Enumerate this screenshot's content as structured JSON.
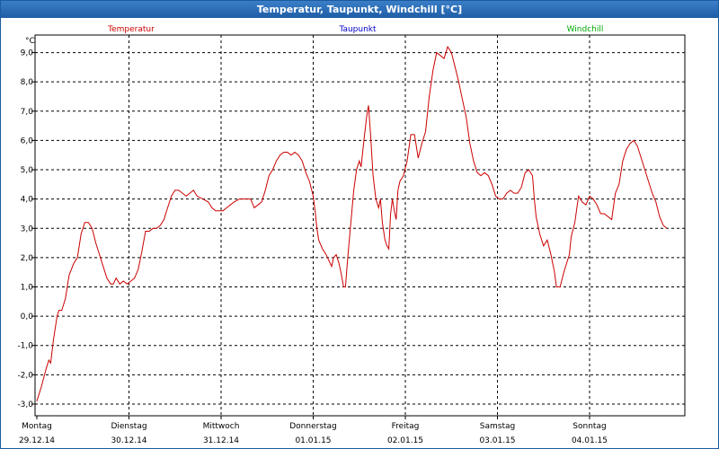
{
  "window": {
    "title": "Temperatur, Taupunkt, Windchill [°C]"
  },
  "legend": {
    "items": [
      {
        "name": "Temperatur",
        "color": "#cc0000"
      },
      {
        "name": "Taupunkt",
        "color": "#0000cc"
      },
      {
        "name": "Windchill",
        "color": "#00aa00"
      }
    ]
  },
  "chart_data": {
    "type": "line",
    "title": "Temperatur, Taupunkt, Windchill [°C]",
    "ylabel": "°C",
    "ylim": [
      -3.4,
      9.6
    ],
    "yticks": [
      -3.0,
      -2.0,
      -1.0,
      0.0,
      1.0,
      2.0,
      3.0,
      4.0,
      5.0,
      6.0,
      7.0,
      8.0,
      9.0
    ],
    "ytick_labels": [
      "-3,0",
      "-2,0",
      "-1,0",
      "0,0",
      "1,0",
      "2,0",
      "3,0",
      "4,0",
      "5,0",
      "6,0",
      "7,0",
      "8,0",
      "9,0"
    ],
    "xlim": [
      0,
      7.0
    ],
    "x_unit": "days since 29.12.14 00:00",
    "xticks": [
      {
        "day": "Montag",
        "date": "29.12.14"
      },
      {
        "day": "Dienstag",
        "date": "30.12.14"
      },
      {
        "day": "Mittwoch",
        "date": "31.12.14"
      },
      {
        "day": "Donnerstag",
        "date": "01.01.15"
      },
      {
        "day": "Freitag",
        "date": "02.01.15"
      },
      {
        "day": "Samstag",
        "date": "03.01.15"
      },
      {
        "day": "Sonntag",
        "date": "04.01.15"
      }
    ],
    "grid": true,
    "series": [
      {
        "name": "Temperatur",
        "color": "#cc0000",
        "points": [
          [
            0.0,
            -2.9
          ],
          [
            0.05,
            -2.4
          ],
          [
            0.1,
            -1.8
          ],
          [
            0.13,
            -1.5
          ],
          [
            0.15,
            -1.6
          ],
          [
            0.18,
            -0.8
          ],
          [
            0.22,
            0.0
          ],
          [
            0.24,
            0.2
          ],
          [
            0.27,
            0.2
          ],
          [
            0.31,
            0.6
          ],
          [
            0.35,
            1.4
          ],
          [
            0.4,
            1.8
          ],
          [
            0.44,
            2.0
          ],
          [
            0.48,
            2.8
          ],
          [
            0.52,
            3.2
          ],
          [
            0.56,
            3.2
          ],
          [
            0.6,
            3.0
          ],
          [
            0.64,
            2.5
          ],
          [
            0.68,
            2.1
          ],
          [
            0.72,
            1.7
          ],
          [
            0.76,
            1.3
          ],
          [
            0.8,
            1.1
          ],
          [
            0.83,
            1.1
          ],
          [
            0.86,
            1.3
          ],
          [
            0.9,
            1.1
          ],
          [
            0.94,
            1.2
          ],
          [
            0.98,
            1.1
          ],
          [
            1.02,
            1.2
          ],
          [
            1.06,
            1.3
          ],
          [
            1.1,
            1.6
          ],
          [
            1.14,
            2.2
          ],
          [
            1.18,
            2.9
          ],
          [
            1.22,
            2.9
          ],
          [
            1.26,
            3.0
          ],
          [
            1.3,
            3.0
          ],
          [
            1.34,
            3.1
          ],
          [
            1.38,
            3.3
          ],
          [
            1.42,
            3.7
          ],
          [
            1.46,
            4.1
          ],
          [
            1.5,
            4.3
          ],
          [
            1.54,
            4.3
          ],
          [
            1.58,
            4.2
          ],
          [
            1.62,
            4.1
          ],
          [
            1.66,
            4.2
          ],
          [
            1.7,
            4.3
          ],
          [
            1.74,
            4.1
          ],
          [
            1.8,
            4.0
          ],
          [
            1.86,
            3.9
          ],
          [
            1.9,
            3.7
          ],
          [
            1.94,
            3.6
          ],
          [
            1.98,
            3.6
          ],
          [
            2.02,
            3.6
          ],
          [
            2.06,
            3.7
          ],
          [
            2.1,
            3.8
          ],
          [
            2.14,
            3.9
          ],
          [
            2.2,
            4.0
          ],
          [
            2.26,
            4.0
          ],
          [
            2.32,
            4.0
          ],
          [
            2.36,
            3.7
          ],
          [
            2.4,
            3.8
          ],
          [
            2.44,
            3.9
          ],
          [
            2.48,
            4.3
          ],
          [
            2.52,
            4.8
          ],
          [
            2.56,
            5.0
          ],
          [
            2.6,
            5.3
          ],
          [
            2.64,
            5.5
          ],
          [
            2.68,
            5.6
          ],
          [
            2.72,
            5.6
          ],
          [
            2.76,
            5.5
          ],
          [
            2.8,
            5.6
          ],
          [
            2.84,
            5.5
          ],
          [
            2.88,
            5.3
          ],
          [
            2.92,
            4.9
          ],
          [
            2.96,
            4.6
          ],
          [
            3.0,
            4.1
          ],
          [
            3.02,
            3.6
          ],
          [
            3.04,
            3.0
          ],
          [
            3.06,
            2.6
          ],
          [
            3.1,
            2.3
          ],
          [
            3.14,
            2.1
          ],
          [
            3.17,
            1.9
          ],
          [
            3.2,
            1.7
          ],
          [
            3.22,
            2.0
          ],
          [
            3.25,
            2.1
          ],
          [
            3.28,
            1.8
          ],
          [
            3.3,
            1.5
          ],
          [
            3.33,
            1.0
          ],
          [
            3.35,
            1.0
          ],
          [
            3.37,
            1.8
          ],
          [
            3.4,
            2.9
          ],
          [
            3.44,
            4.3
          ],
          [
            3.47,
            5.0
          ],
          [
            3.5,
            5.3
          ],
          [
            3.52,
            5.1
          ],
          [
            3.55,
            6.0
          ],
          [
            3.58,
            6.8
          ],
          [
            3.6,
            7.2
          ],
          [
            3.62,
            6.3
          ],
          [
            3.65,
            4.8
          ],
          [
            3.68,
            4.0
          ],
          [
            3.71,
            3.7
          ],
          [
            3.73,
            4.0
          ],
          [
            3.75,
            3.2
          ],
          [
            3.78,
            2.6
          ],
          [
            3.8,
            2.4
          ],
          [
            3.82,
            2.3
          ],
          [
            3.84,
            3.5
          ],
          [
            3.86,
            4.0
          ],
          [
            3.88,
            3.6
          ],
          [
            3.9,
            3.3
          ],
          [
            3.92,
            4.3
          ],
          [
            3.94,
            4.6
          ],
          [
            3.98,
            4.8
          ],
          [
            4.02,
            5.3
          ],
          [
            4.06,
            6.2
          ],
          [
            4.1,
            6.2
          ],
          [
            4.14,
            5.4
          ],
          [
            4.18,
            5.9
          ],
          [
            4.22,
            6.3
          ],
          [
            4.26,
            7.5
          ],
          [
            4.3,
            8.4
          ],
          [
            4.34,
            9.0
          ],
          [
            4.38,
            8.9
          ],
          [
            4.42,
            8.8
          ],
          [
            4.46,
            9.2
          ],
          [
            4.5,
            9.0
          ],
          [
            4.54,
            8.5
          ],
          [
            4.58,
            8.0
          ],
          [
            4.62,
            7.4
          ],
          [
            4.66,
            6.8
          ],
          [
            4.7,
            5.9
          ],
          [
            4.74,
            5.3
          ],
          [
            4.78,
            4.9
          ],
          [
            4.82,
            4.8
          ],
          [
            4.86,
            4.9
          ],
          [
            4.9,
            4.8
          ],
          [
            4.94,
            4.5
          ],
          [
            4.98,
            4.1
          ],
          [
            5.02,
            4.0
          ],
          [
            5.06,
            4.0
          ],
          [
            5.1,
            4.2
          ],
          [
            5.14,
            4.3
          ],
          [
            5.18,
            4.2
          ],
          [
            5.22,
            4.2
          ],
          [
            5.26,
            4.4
          ],
          [
            5.3,
            4.9
          ],
          [
            5.34,
            5.0
          ],
          [
            5.38,
            4.8
          ],
          [
            5.4,
            4.0
          ],
          [
            5.42,
            3.4
          ],
          [
            5.46,
            2.8
          ],
          [
            5.5,
            2.4
          ],
          [
            5.54,
            2.6
          ],
          [
            5.58,
            2.1
          ],
          [
            5.62,
            1.5
          ],
          [
            5.64,
            1.0
          ],
          [
            5.68,
            1.0
          ],
          [
            5.72,
            1.5
          ],
          [
            5.76,
            1.9
          ],
          [
            5.78,
            2.1
          ],
          [
            5.8,
            2.7
          ],
          [
            5.84,
            3.2
          ],
          [
            5.88,
            4.1
          ],
          [
            5.92,
            3.9
          ],
          [
            5.96,
            3.8
          ],
          [
            6.0,
            4.1
          ],
          [
            6.04,
            4.0
          ],
          [
            6.08,
            3.8
          ],
          [
            6.12,
            3.5
          ],
          [
            6.16,
            3.5
          ],
          [
            6.2,
            3.4
          ],
          [
            6.24,
            3.3
          ],
          [
            6.28,
            4.2
          ],
          [
            6.32,
            4.5
          ],
          [
            6.36,
            5.3
          ],
          [
            6.4,
            5.7
          ],
          [
            6.44,
            5.9
          ],
          [
            6.48,
            6.0
          ],
          [
            6.52,
            5.8
          ],
          [
            6.56,
            5.4
          ],
          [
            6.6,
            5.0
          ],
          [
            6.64,
            4.6
          ],
          [
            6.68,
            4.2
          ],
          [
            6.72,
            3.9
          ],
          [
            6.76,
            3.4
          ],
          [
            6.8,
            3.1
          ],
          [
            6.84,
            3.0
          ]
        ]
      },
      {
        "name": "Taupunkt",
        "color": "#0000cc",
        "points": []
      },
      {
        "name": "Windchill",
        "color": "#00aa00",
        "points": []
      }
    ]
  }
}
